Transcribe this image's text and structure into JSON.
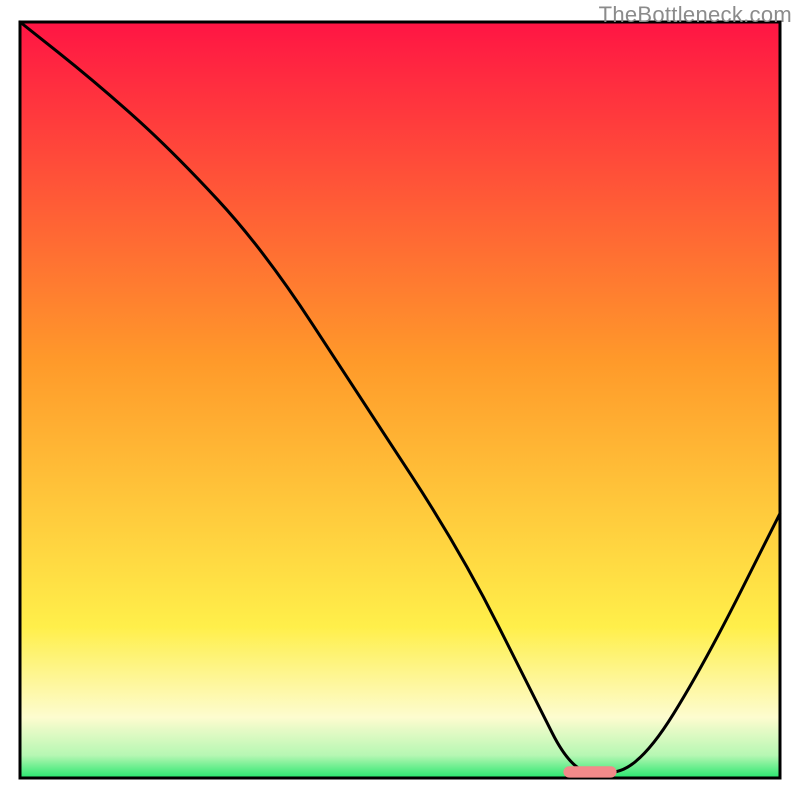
{
  "watermark": "TheBottleneck.com",
  "chart_data": {
    "type": "line",
    "title": "",
    "xlabel": "",
    "ylabel": "",
    "xlim": [
      0,
      100
    ],
    "ylim": [
      0,
      100
    ],
    "background_gradient": {
      "stops": [
        {
          "offset": 0.0,
          "color": "#ff1544"
        },
        {
          "offset": 0.45,
          "color": "#ff9a2a"
        },
        {
          "offset": 0.8,
          "color": "#ffef4a"
        },
        {
          "offset": 0.92,
          "color": "#fdfccf"
        },
        {
          "offset": 0.97,
          "color": "#b6f7b3"
        },
        {
          "offset": 1.0,
          "color": "#27e66e"
        }
      ]
    },
    "series": [
      {
        "name": "bottleneck-curve",
        "color": "#000000",
        "x": [
          0,
          10,
          20,
          32,
          45,
          58,
          68,
          72,
          76,
          82,
          90,
          100
        ],
        "y": [
          100,
          92,
          83,
          70,
          50,
          30,
          10,
          2,
          0,
          2,
          15,
          35
        ]
      }
    ],
    "highlight_marker": {
      "x": 75,
      "y": 0.8,
      "width": 7,
      "height": 1.5,
      "color": "#f28a8a"
    }
  }
}
